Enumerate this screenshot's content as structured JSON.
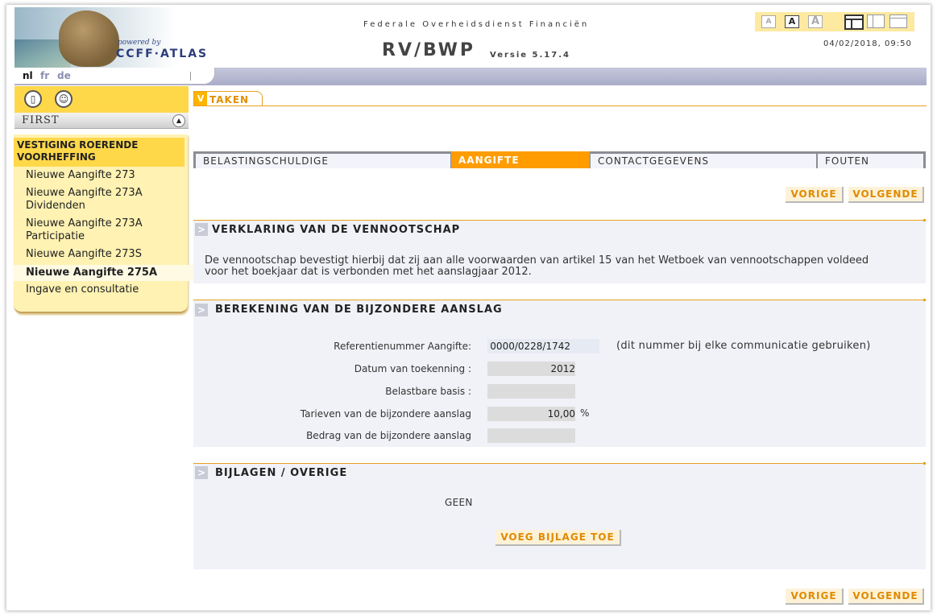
{
  "header": {
    "logo_powered": "powered by",
    "logo_brand": "CCFF·ATLAS",
    "agency": "Federale Overheidsdienst Financiën",
    "app_title": "RV/BWP",
    "version": "Versie 5.17.4",
    "datetime": "04/02/2018, 09:50",
    "font_sizes": [
      "A",
      "A",
      "A"
    ]
  },
  "languages": [
    "nl",
    "fr",
    "de"
  ],
  "sidebar": {
    "first_label": "FIRST",
    "menu_title": "VESTIGING ROERENDE VOORHEFFING",
    "items": [
      {
        "label": "Nieuwe Aangifte 273"
      },
      {
        "label": "Nieuwe Aangifte 273A Dividenden"
      },
      {
        "label": "Nieuwe Aangifte 273A Participatie"
      },
      {
        "label": "Nieuwe Aangifte 273S"
      },
      {
        "label": "Nieuwe Aangifte 275A"
      },
      {
        "label": "Ingave en consultatie"
      }
    ],
    "selected_index": 4
  },
  "taken_label": "TAKEN",
  "tabs": [
    "BELASTINGSCHULDIGE",
    "AANGIFTE",
    "CONTACTGEGEVENS",
    "FOUTEN"
  ],
  "active_tab": "AANGIFTE",
  "nav": {
    "prev": "VORIGE",
    "next": "VOLGENDE"
  },
  "verklaring": {
    "title": "VERKLARING VAN DE VENNOOTSCHAP",
    "text_line1": "De vennootschap bevestigt hierbij dat zij aan alle voorwaarden van artikel 15 van het Wetboek van vennootschappen voldeed",
    "text_line2": "voor het boekjaar dat is verbonden met het aanslagjaar 2012."
  },
  "berekening": {
    "title": "BEREKENING VAN DE BIJZONDERE AANSLAG",
    "fields": [
      {
        "label": "Referentienummer Aangifte:",
        "value": "0000/0228/1742"
      },
      {
        "label": "Datum van toekenning :",
        "value": "2012"
      },
      {
        "label": "Belastbare basis :",
        "value": ""
      },
      {
        "label": "Tarieven van de bijzondere aanslag",
        "value": "10,00"
      },
      {
        "label": "Bedrag van de bijzondere aanslag",
        "value": ""
      }
    ],
    "ref_note": "(dit nummer bij elke communicatie gebruiken)",
    "rate_unit": "%"
  },
  "bijlagen": {
    "title": "BIJLAGEN / OVERIGE",
    "status": "GEEN",
    "add_button": "VOEG BIJLAGE TOE"
  }
}
